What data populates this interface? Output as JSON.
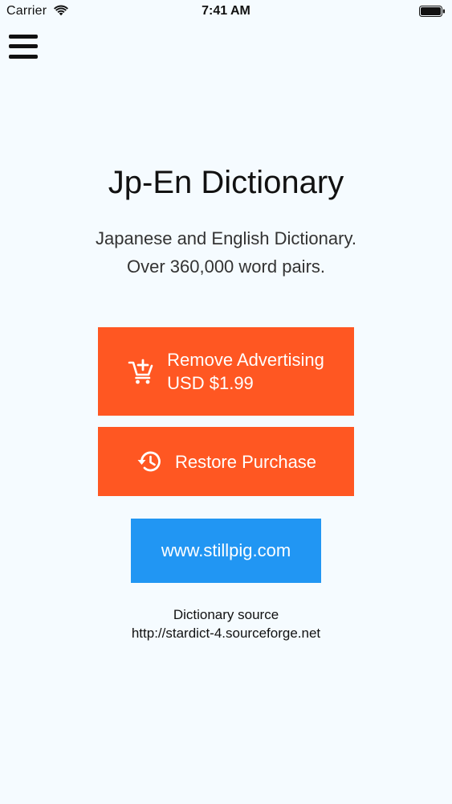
{
  "status_bar": {
    "carrier": "Carrier",
    "time": "7:41 AM",
    "wifi_icon": "wifi-icon",
    "battery_icon": "battery-icon"
  },
  "menu": {
    "icon": "hamburger-menu-icon"
  },
  "header": {
    "title": "Jp-En Dictionary",
    "subtitle_line1": "Japanese and English Dictionary.",
    "subtitle_line2": "Over 360,000 word pairs."
  },
  "buttons": {
    "remove_ads": {
      "label": "Remove Advertising",
      "price": "USD $1.99",
      "icon": "add-to-cart-icon"
    },
    "restore": {
      "label": "Restore Purchase",
      "icon": "restore-history-icon"
    },
    "website": {
      "label": "www.stillpig.com"
    }
  },
  "footer": {
    "source_label": "Dictionary source",
    "source_url": "http://stardict-4.sourceforge.net"
  },
  "colors": {
    "background": "#f5fbff",
    "accent_orange": "#ff5722",
    "accent_blue": "#2196f3",
    "text_primary": "#111111",
    "text_secondary": "#333333"
  }
}
